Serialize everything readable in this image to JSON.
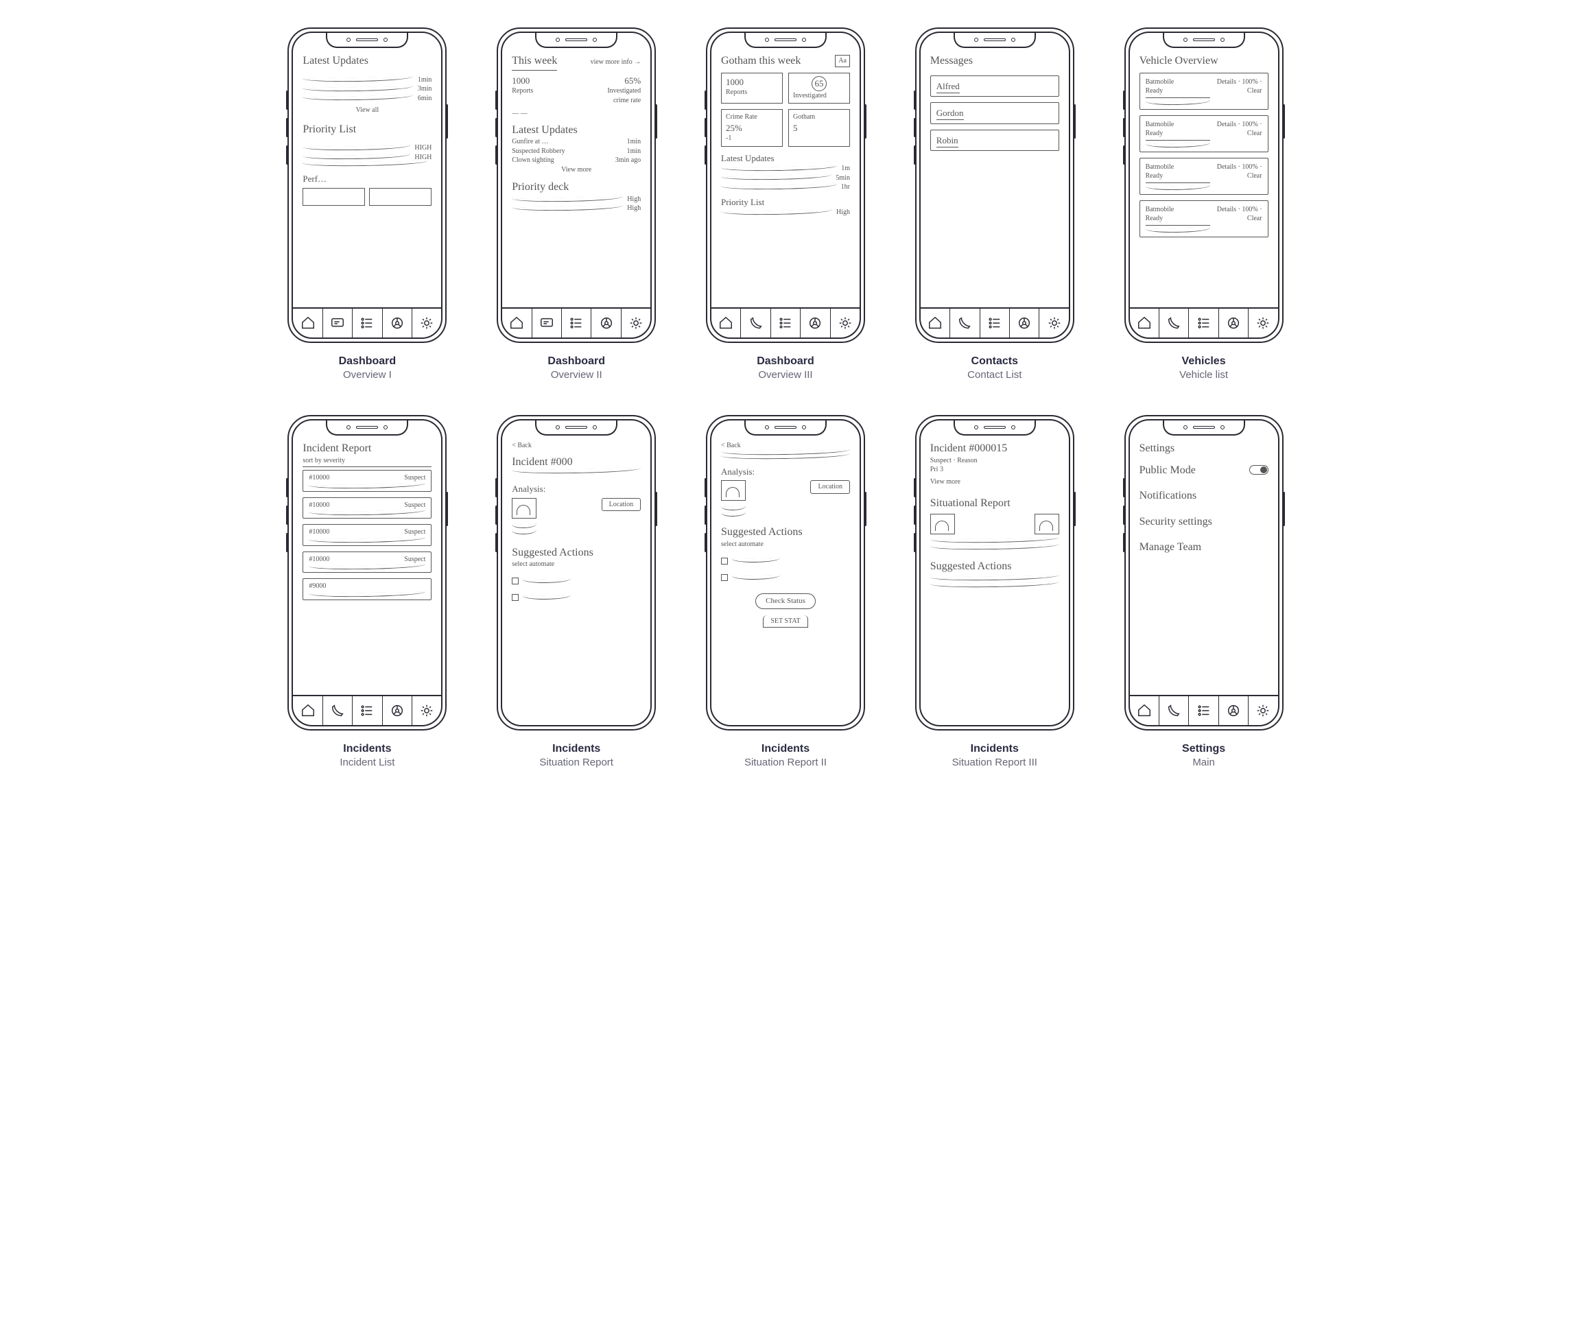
{
  "tabbar_set_a": [
    "home",
    "chat",
    "list",
    "wheel",
    "gear"
  ],
  "tabbar_set_b": [
    "home",
    "phone",
    "list",
    "wheel",
    "gear"
  ],
  "screens": [
    {
      "id": "dash1",
      "caption": {
        "title": "Dashboard",
        "sub": "Overview I"
      },
      "tabbar": "a",
      "sections": {
        "h1": "Latest Updates",
        "updates": [
          "1min",
          "3min",
          "6min"
        ],
        "view_all": "View all",
        "h2": "Priority List",
        "priority": [
          "HIGH",
          "HIGH",
          ""
        ],
        "h3": "Perf…"
      }
    },
    {
      "id": "dash2",
      "caption": {
        "title": "Dashboard",
        "sub": "Overview II"
      },
      "tabbar": "a",
      "sections": {
        "h1": "This week",
        "view_more": "view more info →",
        "stats": [
          [
            "1000",
            "65%"
          ],
          [
            "Reports",
            "Investigated"
          ]
        ],
        "extra": "crime rate",
        "dashes": "— —",
        "h2": "Latest Updates",
        "updates": [
          [
            "Gunfire at …",
            "1min"
          ],
          [
            "Suspected Robbery",
            "1min"
          ],
          [
            "Clown sighting",
            "3min ago"
          ]
        ],
        "view_more2": "View more",
        "h3": "Priority deck",
        "priority": [
          "High",
          "High"
        ]
      }
    },
    {
      "id": "dash3",
      "caption": {
        "title": "Dashboard",
        "sub": "Overview III"
      },
      "tabbar": "b",
      "sections": {
        "h1": "Gotham this week",
        "badge": "Aa",
        "cards": [
          {
            "big": "1000",
            "small": "Reports"
          },
          {
            "big": "65",
            "small": "Investigated",
            "ring": true
          },
          {
            "title": "Crime Rate",
            "big": "25%",
            "sub": "-1"
          },
          {
            "title": "Gotham",
            "big": "5"
          }
        ],
        "h2": "Latest Updates",
        "updates": [
          "1m",
          "5min",
          "1hr"
        ],
        "h3": "Priority List",
        "p_val": "High"
      }
    },
    {
      "id": "contacts",
      "caption": {
        "title": "Contacts",
        "sub": "Contact List"
      },
      "tabbar": "b",
      "sections": {
        "h1": "Messages",
        "items": [
          "Alfred",
          "Gordon",
          "Robin"
        ]
      }
    },
    {
      "id": "vehicles",
      "caption": {
        "title": "Vehicles",
        "sub": "Vehicle list"
      },
      "tabbar": "b",
      "sections": {
        "h1": "Vehicle Overview",
        "items": [
          {
            "name": "Batmobile",
            "sub": "Ready",
            "meta": "Details · 100% · Clear"
          },
          {
            "name": "Batmobile",
            "sub": "Ready",
            "meta": "Details · 100% · Clear"
          },
          {
            "name": "Batmobile",
            "sub": "Ready",
            "meta": "Details · 100% · Clear"
          },
          {
            "name": "Batmobile",
            "sub": "Ready",
            "meta": "Details · 100% · Clear"
          }
        ]
      }
    },
    {
      "id": "inc_list",
      "caption": {
        "title": "Incidents",
        "sub": "Incident List"
      },
      "tabbar": "b",
      "sections": {
        "h1": "Incident Report",
        "sort": "sort by severity",
        "items": [
          {
            "id": "#10000",
            "sev": "Suspect"
          },
          {
            "id": "#10000",
            "sev": "Suspect"
          },
          {
            "id": "#10000",
            "sev": "Suspect"
          },
          {
            "id": "#10000",
            "sev": "Suspect"
          },
          {
            "id": "#9000",
            "sev": ""
          }
        ]
      }
    },
    {
      "id": "sitrep1",
      "caption": {
        "title": "Incidents",
        "sub": "Situation Report"
      },
      "tabbar": "none",
      "sections": {
        "back": "< Back",
        "h1": "Incident #000",
        "h2": "Analysis:",
        "location": "Location",
        "h3": "Suggested Actions",
        "sub": "select automate",
        "checks": 2
      }
    },
    {
      "id": "sitrep2",
      "caption": {
        "title": "Incidents",
        "sub": "Situation Report II"
      },
      "tabbar": "none",
      "sections": {
        "back": "< Back",
        "h2": "Analysis:",
        "location": "Location",
        "h3": "Suggested Actions",
        "sub": "select automate",
        "checks": 2,
        "cta": "Check Status",
        "cta2": "SET STAT"
      }
    },
    {
      "id": "sitrep3",
      "caption": {
        "title": "Incidents",
        "sub": "Situation Report III"
      },
      "tabbar": "none",
      "sections": {
        "h1": "Incident #000015",
        "meta1": "Suspect · Reason",
        "meta2": "Pri 3",
        "view": "View more",
        "h2": "Situational Report",
        "h3": "Suggested Actions"
      }
    },
    {
      "id": "settings",
      "caption": {
        "title": "Settings",
        "sub": "Main"
      },
      "tabbar": "b",
      "sections": {
        "h1": "Settings",
        "items": [
          "Public Mode",
          "Notifications",
          "Security settings",
          "Manage Team"
        ],
        "toggle_on": 0
      }
    }
  ]
}
